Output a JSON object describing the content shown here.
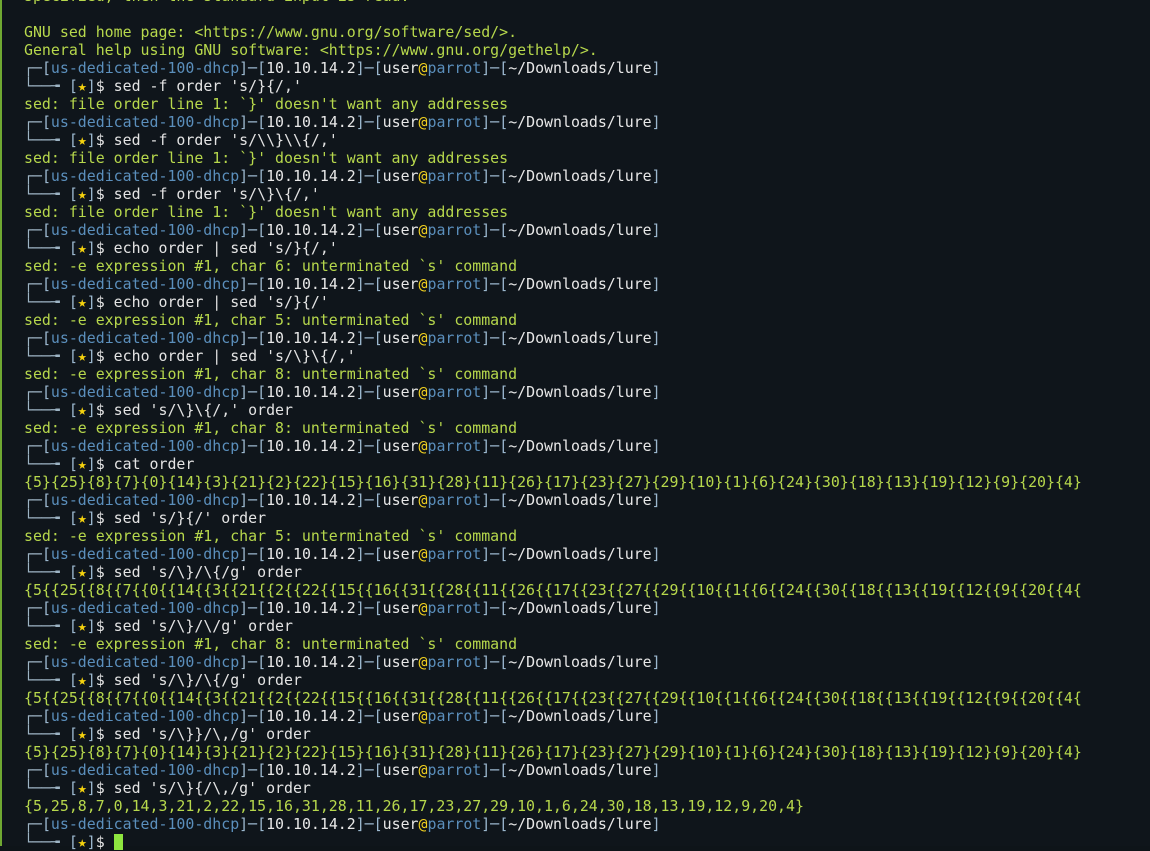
{
  "prompt": {
    "hostname": "us-dedicated-100-dhcp",
    "ip": "10.10.14.2",
    "user": "user",
    "at": "@",
    "host": "parrot",
    "path": "~/Downloads/lure",
    "star": "★",
    "dollar": "$"
  },
  "header_lines": [
    "specified, then the standard input is read.",
    "",
    "GNU sed home page: <https://www.gnu.org/software/sed/>.",
    "General help using GNU software: <https://www.gnu.org/gethelp/>."
  ],
  "entries": [
    {
      "command": "sed -f order 's/}{/,'",
      "output": [
        "sed: file order line 1: `}' doesn't want any addresses"
      ]
    },
    {
      "command": "sed -f order 's/\\\\}\\\\{/,'",
      "output": [
        "sed: file order line 1: `}' doesn't want any addresses"
      ]
    },
    {
      "command": "sed -f order 's/\\}\\{/,'",
      "output": [
        "sed: file order line 1: `}' doesn't want any addresses"
      ]
    },
    {
      "command": "echo order | sed 's/}{/,'",
      "output": [
        "sed: -e expression #1, char 6: unterminated `s' command"
      ]
    },
    {
      "command": "echo order | sed 's/}{/'",
      "output": [
        "sed: -e expression #1, char 5: unterminated `s' command"
      ]
    },
    {
      "command": "echo order | sed 's/\\}\\{/,'",
      "output": [
        "sed: -e expression #1, char 8: unterminated `s' command"
      ]
    },
    {
      "command": "sed 's/\\}\\{/,' order",
      "output": [
        "sed: -e expression #1, char 8: unterminated `s' command"
      ]
    },
    {
      "command": "cat order",
      "output": [
        "{5}{25}{8}{7}{0}{14}{3}{21}{2}{22}{15}{16}{31}{28}{11}{26}{17}{23}{27}{29}{10}{1}{6}{24}{30}{18}{13}{19}{12}{9}{20}{4}"
      ]
    },
    {
      "command": "sed 's/}{/' order",
      "output": [
        "sed: -e expression #1, char 5: unterminated `s' command"
      ]
    },
    {
      "command": "sed 's/\\}/\\{/g' order",
      "output": [
        "{5{{25{{8{{7{{0{{14{{3{{21{{2{{22{{15{{16{{31{{28{{11{{26{{17{{23{{27{{29{{10{{1{{6{{24{{30{{18{{13{{19{{12{{9{{20{{4{"
      ]
    },
    {
      "command": "sed 's/\\}/\\/g' order",
      "output": [
        "sed: -e expression #1, char 8: unterminated `s' command"
      ]
    },
    {
      "command": "sed 's/\\}/\\{/g' order",
      "output": [
        "{5{{25{{8{{7{{0{{14{{3{{21{{2{{22{{15{{16{{31{{28{{11{{26{{17{{23{{27{{29{{10{{1{{6{{24{{30{{18{{13{{19{{12{{9{{20{{4{"
      ]
    },
    {
      "command": "sed 's/\\}}/\\,/g' order",
      "output": [
        "{5}{25}{8}{7}{0}{14}{3}{21}{2}{22}{15}{16}{31}{28}{11}{26}{17}{23}{27}{29}{10}{1}{6}{24}{30}{18}{13}{19}{12}{9}{20}{4}"
      ]
    },
    {
      "command": "sed 's/\\}{/\\,/g' order",
      "output": [
        "{5,25,8,7,0,14,3,21,2,22,15,16,31,28,11,26,17,23,27,29,10,1,6,24,30,18,13,19,12,9,20,4}"
      ]
    },
    {
      "command": "",
      "output": []
    }
  ],
  "colors": {
    "background": "#0f151b",
    "output_text": "#b7d84c",
    "hostname": "#5b8fbc",
    "star": "#f5d20e",
    "cursor": "#8ee53f"
  }
}
